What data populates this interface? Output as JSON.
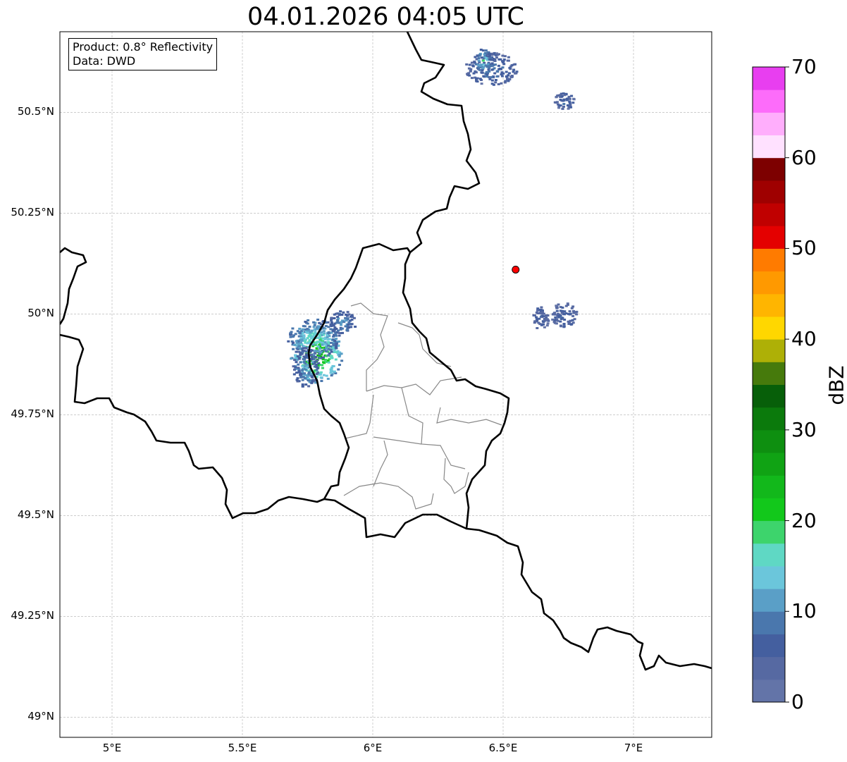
{
  "title": "04.01.2026 04:05 UTC",
  "info_box": {
    "product": "Product: 0.8° Reflectivity",
    "source": "Data: DWD"
  },
  "map": {
    "lon_range": [
      4.8,
      7.3
    ],
    "lat_range": [
      48.95,
      50.7
    ],
    "lat_ticks": [
      {
        "value": 50.5,
        "label": "50.5°N"
      },
      {
        "value": 50.25,
        "label": "50.25°N"
      },
      {
        "value": 50.0,
        "label": "50°N"
      },
      {
        "value": 49.75,
        "label": "49.75°N"
      },
      {
        "value": 49.5,
        "label": "49.5°N"
      },
      {
        "value": 49.25,
        "label": "49.25°N"
      },
      {
        "value": 49.0,
        "label": "49°N"
      }
    ],
    "lon_ticks": [
      {
        "value": 5.0,
        "label": "5°E"
      },
      {
        "value": 5.5,
        "label": "5.5°E"
      },
      {
        "value": 6.0,
        "label": "6°E"
      },
      {
        "value": 6.5,
        "label": "6.5°E"
      },
      {
        "value": 7.0,
        "label": "7°E"
      }
    ],
    "gridlines": true,
    "radar_site": {
      "lon": 6.548,
      "lat": 50.11,
      "color": "#ff0000"
    }
  },
  "colorbar": {
    "label": "dBZ",
    "min": 0,
    "max": 70,
    "step": 2.5,
    "tick_labels": [
      "0",
      "10",
      "20",
      "30",
      "40",
      "50",
      "60",
      "70"
    ],
    "colors": [
      "#6374a8",
      "#5669a2",
      "#445f9f",
      "#4a77ad",
      "#5a9fc7",
      "#6bc6db",
      "#5fd8c4",
      "#3dd46c",
      "#12c81b",
      "#12b81b",
      "#10a314",
      "#0e8f10",
      "#0b7a0c",
      "#075f09",
      "#467a0c",
      "#aeb006",
      "#ffd700",
      "#ffb500",
      "#ff9900",
      "#ff7b00",
      "#e40000",
      "#c00000",
      "#9f0000",
      "#7d0000",
      "#ffe1ff",
      "#ffaefc",
      "#fd6cfa",
      "#e83ef0"
    ]
  },
  "precip_cells": [
    {
      "lon": 5.78,
      "lat": 49.9,
      "rlon": 0.1,
      "rlat": 0.07,
      "dbz": 25
    },
    {
      "lon": 5.77,
      "lat": 49.94,
      "rlon": 0.1,
      "rlat": 0.05,
      "dbz": 15
    },
    {
      "lon": 5.74,
      "lat": 49.87,
      "rlon": 0.05,
      "rlat": 0.05,
      "dbz": 10
    },
    {
      "lon": 5.88,
      "lat": 49.98,
      "rlon": 0.05,
      "rlat": 0.03,
      "dbz": 10
    },
    {
      "lon": 6.45,
      "lat": 50.61,
      "rlon": 0.1,
      "rlat": 0.04,
      "dbz": 7
    },
    {
      "lon": 6.42,
      "lat": 50.63,
      "rlon": 0.03,
      "rlat": 0.03,
      "dbz": 15
    },
    {
      "lon": 6.73,
      "lat": 50.53,
      "rlon": 0.04,
      "rlat": 0.02,
      "dbz": 5
    },
    {
      "lon": 6.73,
      "lat": 50.0,
      "rlon": 0.05,
      "rlat": 0.03,
      "dbz": 5
    },
    {
      "lon": 6.64,
      "lat": 49.99,
      "rlon": 0.03,
      "rlat": 0.03,
      "dbz": 5
    }
  ]
}
